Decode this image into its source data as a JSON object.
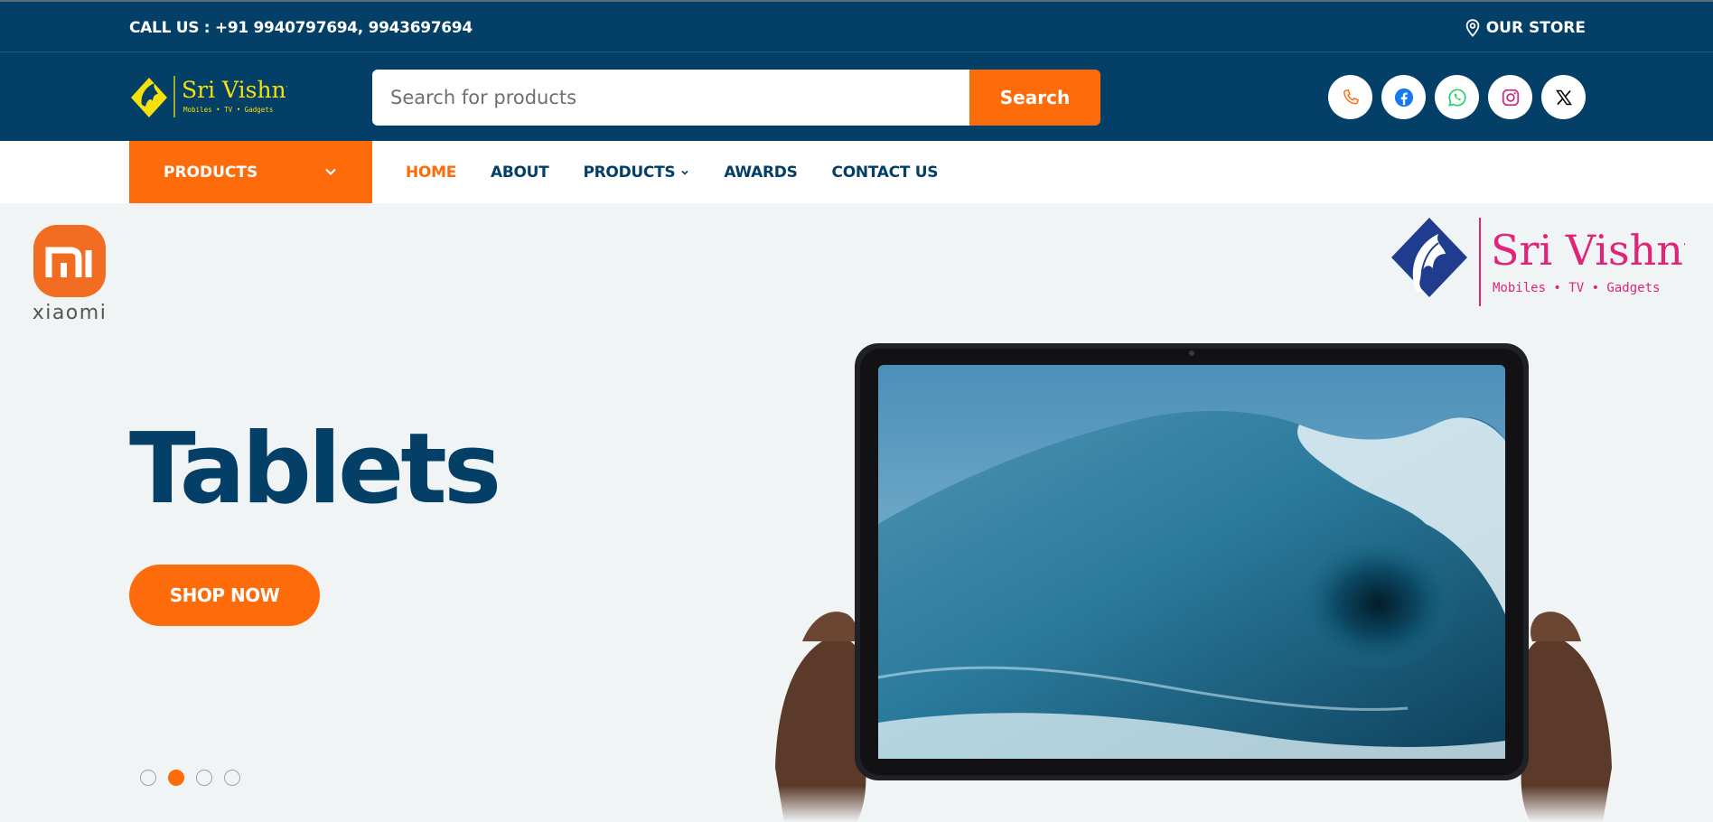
{
  "topbar": {
    "call_text": "CALL US : +91 9940797694, 9943697694",
    "store_label": "OUR STORE",
    "store_icon": "map-pin-icon"
  },
  "header": {
    "logo": {
      "name": "Sri Vishnu",
      "tagline": "Mobiles • TV • Gadgets"
    },
    "search": {
      "placeholder": "Search for products",
      "value": "",
      "button_label": "Search"
    },
    "socials": [
      "phone-icon",
      "facebook-icon",
      "whatsapp-icon",
      "instagram-icon",
      "x-icon"
    ]
  },
  "nav": {
    "category_button": "PRODUCTS",
    "items": [
      {
        "label": "HOME",
        "active": true
      },
      {
        "label": "ABOUT",
        "active": false
      },
      {
        "label": "PRODUCTS",
        "active": false,
        "dropdown": true
      },
      {
        "label": "AWARDS",
        "active": false
      },
      {
        "label": "CONTACT US",
        "active": false
      }
    ]
  },
  "hero": {
    "partner_logo": {
      "text": "xiaomi"
    },
    "brand_logo": {
      "name": "Sri Vishnu",
      "tagline": "Mobiles • TV • Gadgets"
    },
    "title": "Tablets",
    "cta_label": "SHOP NOW",
    "slide_count": 4,
    "active_slide": 2
  },
  "colors": {
    "navy": "#033f66",
    "orange": "#fd6b0b",
    "hero_bg": "#f1f4f5",
    "logo_yellow": "#f6e10b",
    "brand_pink": "#e0247a"
  }
}
